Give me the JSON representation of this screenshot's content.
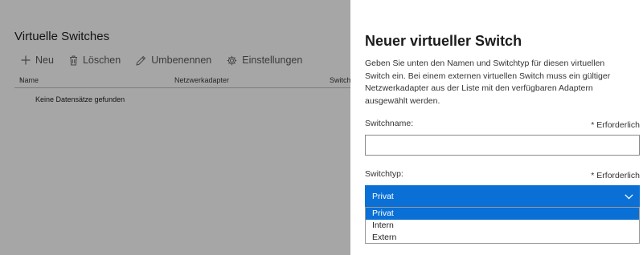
{
  "list_page": {
    "title": "Virtuelle Switches",
    "toolbar": {
      "new_label": "Neu",
      "delete_label": "Löschen",
      "rename_label": "Umbenennen",
      "settings_label": "Einstellungen"
    },
    "columns": {
      "name": "Name",
      "adapter": "Netzwerkadapter",
      "switch": "Switch"
    },
    "empty_text": "Keine Datensätze gefunden"
  },
  "panel": {
    "title": "Neuer virtueller Switch",
    "description": "Geben Sie unten den Namen und Switchtyp für diesen virtuellen Switch ein. Bei einem externen virtuellen Switch muss ein gültiger Netzwerkadapter aus der Liste mit den verfügbaren Adaptern ausgewählt werden.",
    "switchname_label": "Switchname:",
    "switchname_required": "* Erforderlich",
    "switchname_value": "",
    "switchtype_label": "Switchtyp:",
    "switchtype_required": "* Erforderlich",
    "switchtype_selected": "Privat",
    "switchtype_options": [
      "Privat",
      "Intern",
      "Extern"
    ]
  },
  "colors": {
    "accent": "#0a70d6",
    "overlay": "rgba(0,0,0,0.35)"
  }
}
